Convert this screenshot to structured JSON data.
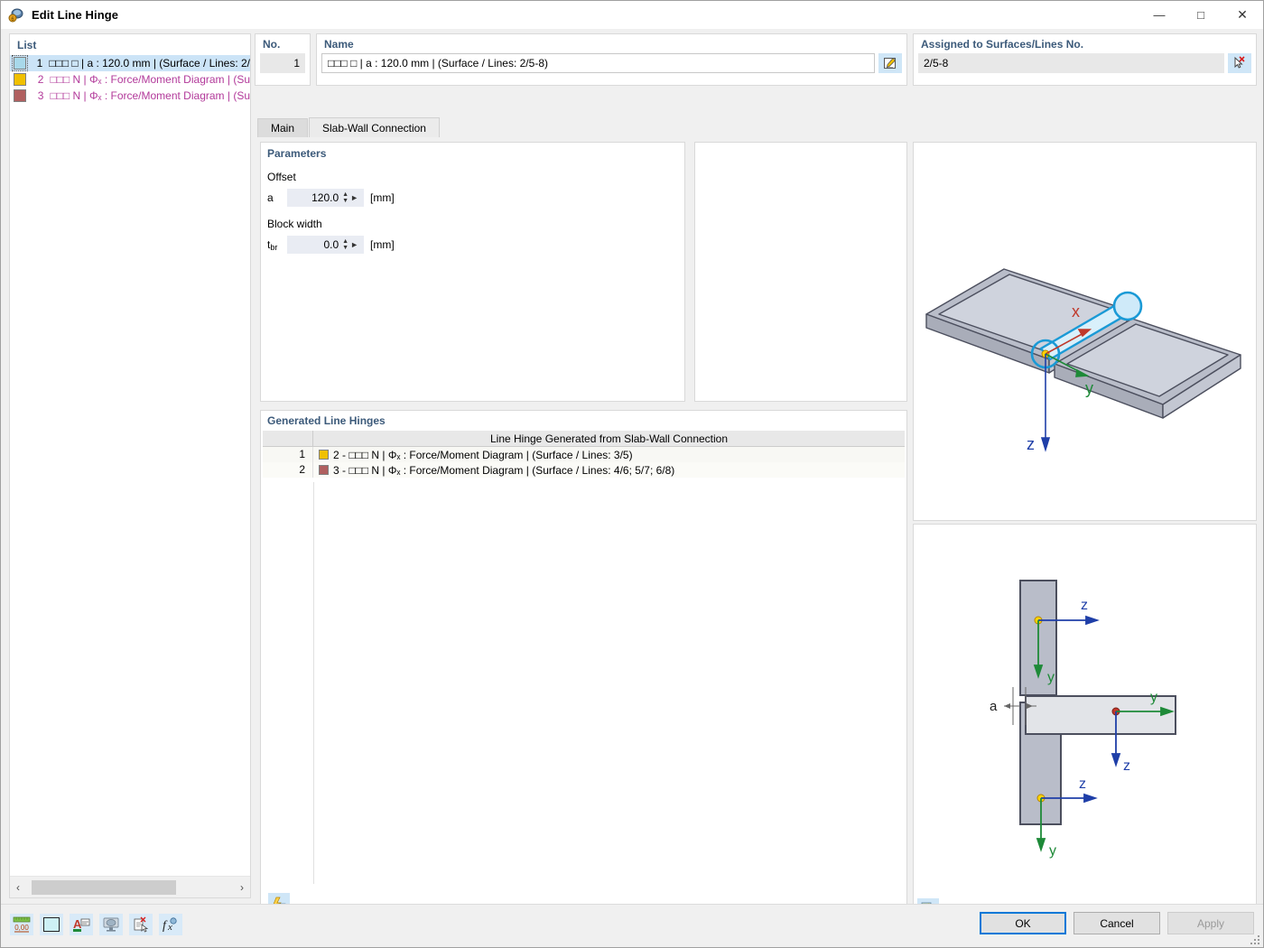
{
  "window": {
    "title": "Edit Line Hinge",
    "app_icon": "line-hinge-icon",
    "minimize": "—",
    "maximize": "□",
    "close": "✕"
  },
  "list_panel": {
    "header": "List",
    "rows": [
      {
        "num": "1",
        "color": "#a8d8ea",
        "text": "□□□ □ | a : 120.0 mm | (Surface / Lines: 2/",
        "selected": true,
        "style": "dark"
      },
      {
        "num": "2",
        "color": "#f0c000",
        "text": "□□□ N | Φₓ : Force/Moment Diagram | (Su",
        "selected": false,
        "style": "violet"
      },
      {
        "num": "3",
        "color": "#b06060",
        "text": "□□□ N | Φₓ : Force/Moment Diagram | (Su",
        "selected": false,
        "style": "violet"
      }
    ],
    "scroll_left": "‹",
    "scroll_right": "›",
    "toolbar": [
      {
        "name": "new-item-button",
        "glyph": "new"
      },
      {
        "name": "copy-item-button",
        "glyph": "copy"
      },
      {
        "name": "check-all-button",
        "glyph": "check"
      },
      {
        "name": "invert-selection-button",
        "glyph": "invert"
      },
      {
        "name": "delete-item-button",
        "glyph": "delete"
      }
    ]
  },
  "no_panel": {
    "label": "No.",
    "value": "1"
  },
  "name_panel": {
    "label": "Name",
    "value": "□□□ □ | a : 120.0 mm | (Surface / Lines: 2/5-8)",
    "edit_button": "edit-name-icon"
  },
  "assigned_panel": {
    "label": "Assigned to Surfaces/Lines No.",
    "value": "2/5-8",
    "pick_button": "deselect-pick-icon"
  },
  "tabs": [
    {
      "label": "Main",
      "active": false
    },
    {
      "label": "Slab-Wall Connection",
      "active": true
    }
  ],
  "parameters": {
    "title": "Parameters",
    "offset_group": "Offset",
    "offset_field": {
      "name": "a",
      "value": "120.0",
      "unit": "[mm]"
    },
    "block_group": "Block width",
    "block_field": {
      "name": "t",
      "name_sub": "br",
      "value": "0.0",
      "unit": "[mm]"
    }
  },
  "generated": {
    "title": "Generated Line Hinges",
    "column_index": "",
    "column_main": "Line Hinge Generated from Slab-Wall Connection",
    "rows": [
      {
        "idx": "1",
        "color": "#f0c000",
        "text": "2 - □□□ N | Φₓ : Force/Moment Diagram | (Surface / Lines: 3/5)"
      },
      {
        "idx": "2",
        "color": "#b06060",
        "text": "3 - □□□ N | Φₓ : Force/Moment Diagram | (Surface / Lines: 4/6; 5/7; 6/8)"
      }
    ],
    "bottom_button": "render-settings-icon"
  },
  "preview_top": {
    "name": "slab-wall-3d-preview",
    "axis_x": "x",
    "axis_y": "y",
    "axis_z": "z",
    "color_hinge": "#1a9ad6",
    "color_slab": "#b0b4c0",
    "color_x": "#c0392b",
    "color_y": "#1e8a38",
    "color_z": "#1f3fa8"
  },
  "preview_bottom": {
    "name": "slab-wall-section-preview",
    "dim_label": "a",
    "upper_wall_z": "z",
    "upper_wall_y": "y",
    "slab_y": "y",
    "slab_z": "z",
    "lower_wall_z": "z",
    "lower_wall_y": "y",
    "bottom_button": "image-export-icon"
  },
  "bottom_bar": {
    "tools": [
      {
        "name": "decimal-places-button",
        "glyph": "0.00"
      },
      {
        "name": "color-swatch-button",
        "glyph": "swatch",
        "color": "#cdf0f5"
      },
      {
        "name": "font-settings-button",
        "glyph": "font"
      },
      {
        "name": "display-properties-button",
        "glyph": "display"
      },
      {
        "name": "clear-selection-button",
        "glyph": "clear"
      },
      {
        "name": "formula-button",
        "glyph": "fx"
      }
    ],
    "buttons": [
      {
        "label": "OK",
        "state": "default"
      },
      {
        "label": "Cancel",
        "state": "normal"
      },
      {
        "label": "Apply",
        "state": "disabled"
      }
    ]
  }
}
